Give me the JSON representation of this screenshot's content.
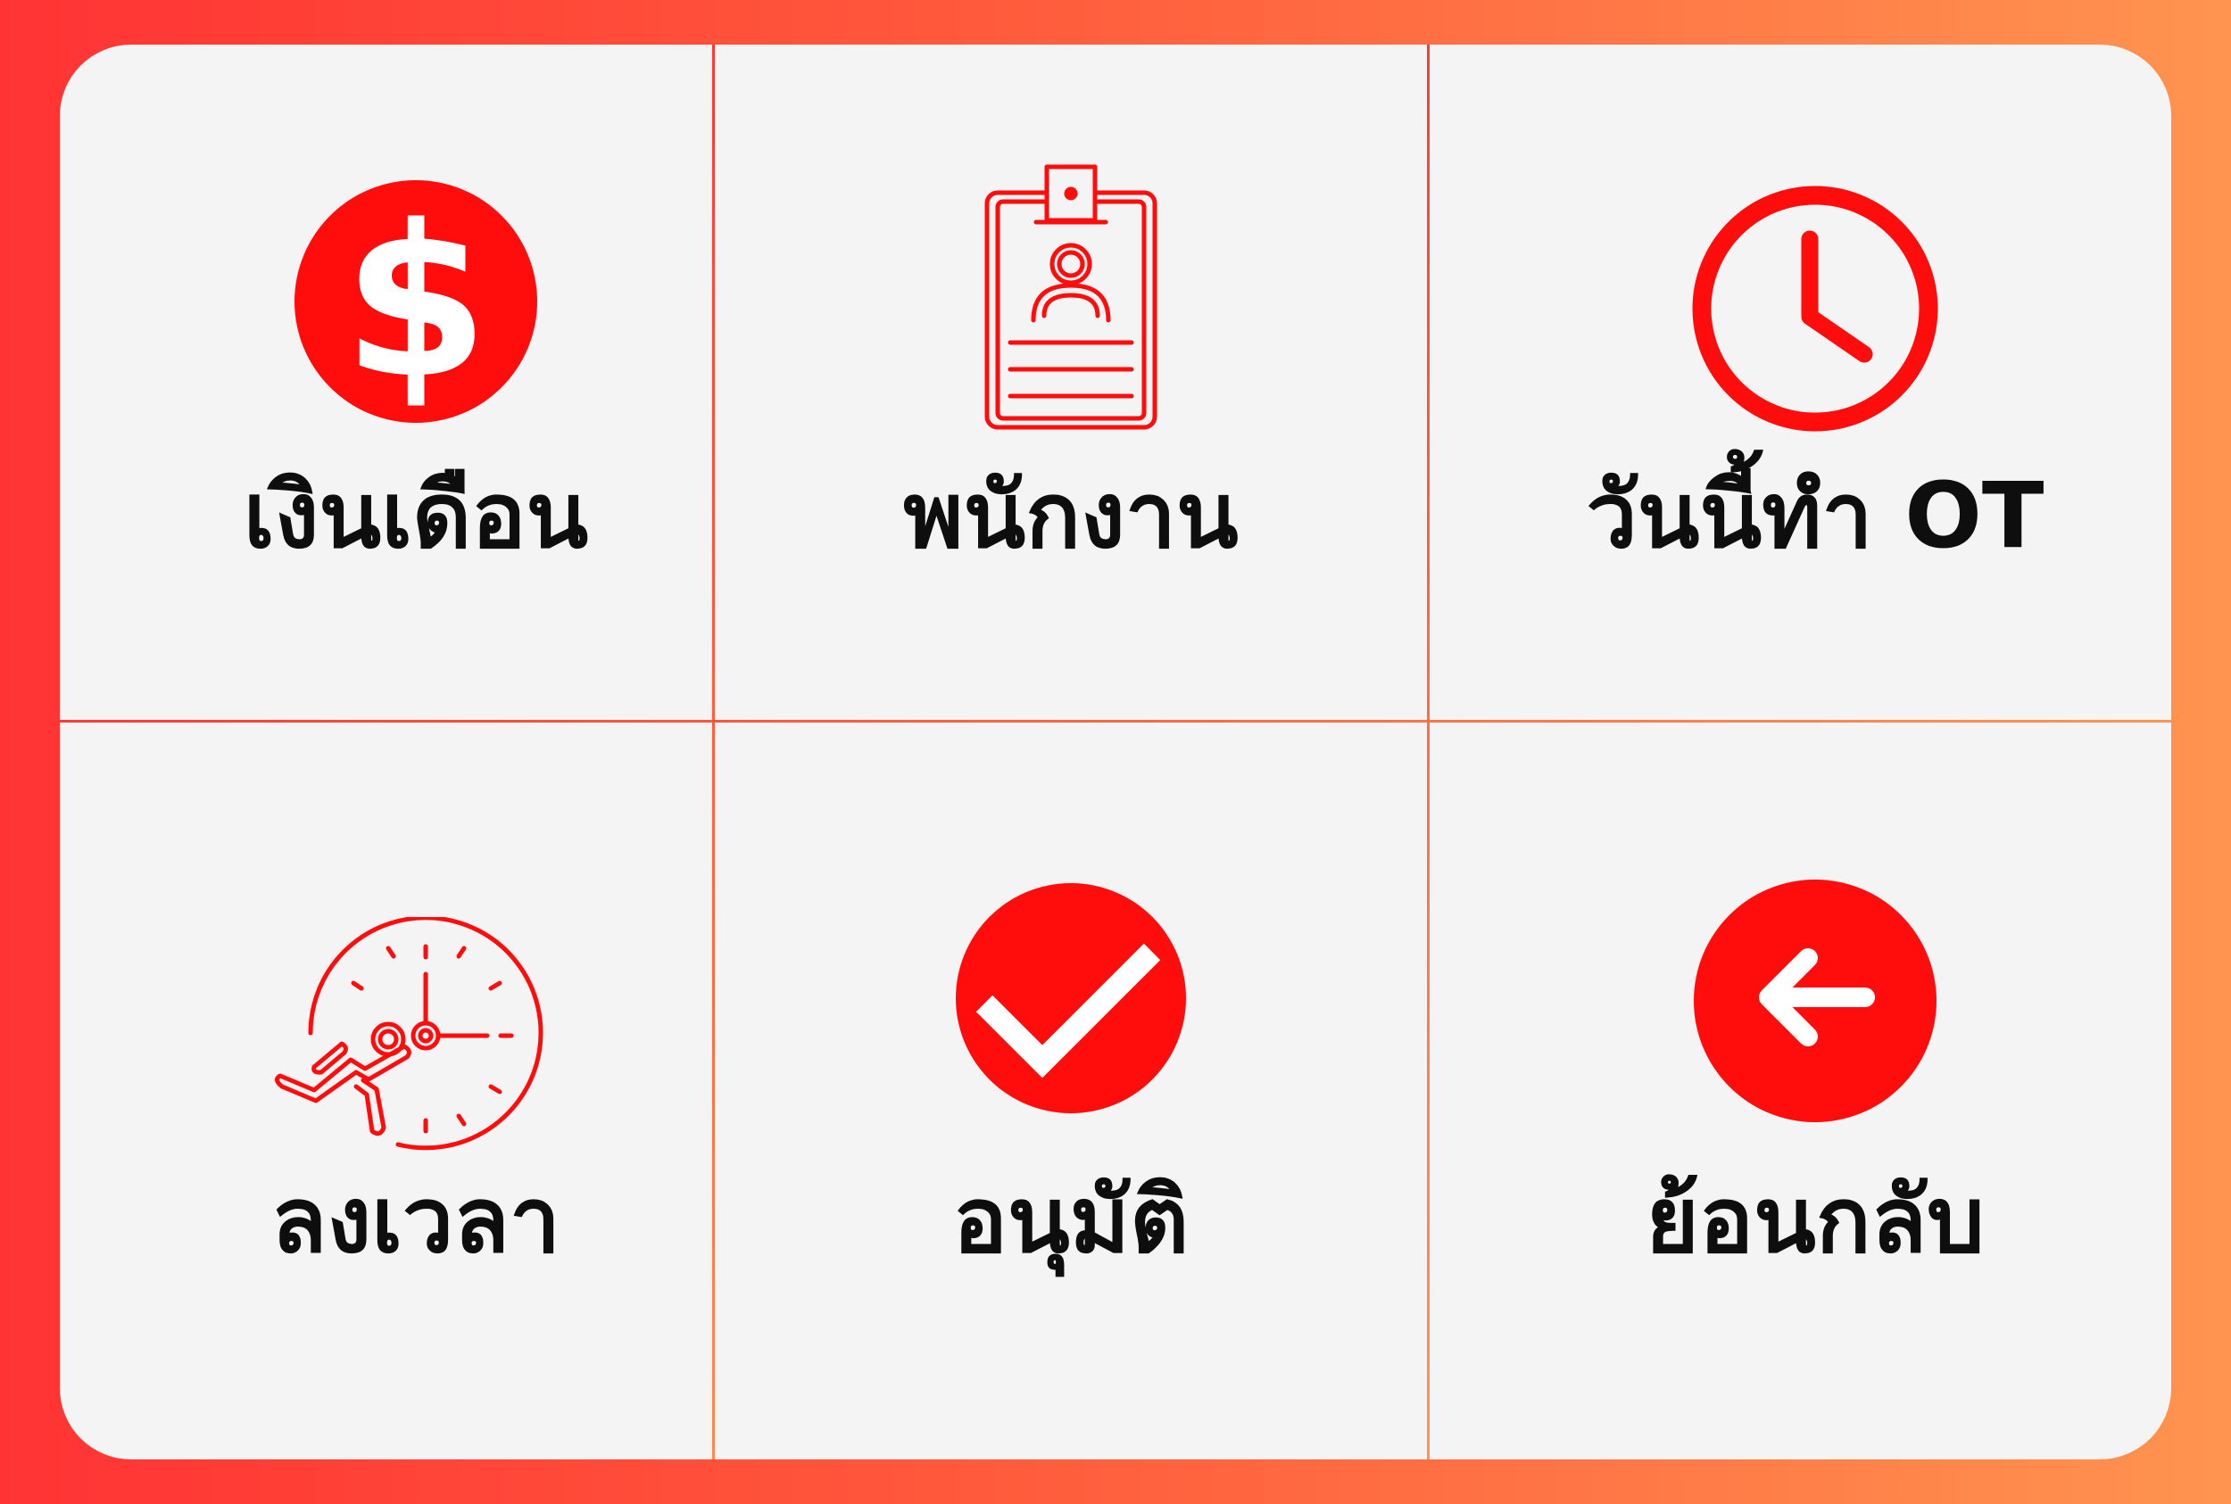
{
  "colors": {
    "accent": "#ff0d0d",
    "panel": "#f4f4f4",
    "text": "#0e0e0e",
    "gradient_start": "#ff3334",
    "gradient_end": "#ff9450"
  },
  "menu": {
    "items": [
      {
        "label": "เงินเดือน",
        "icon": "dollar-circle-icon"
      },
      {
        "label": "พนักงาน",
        "icon": "employee-badge-icon"
      },
      {
        "label": "วันนี้ทำ OT",
        "icon": "clock-icon"
      },
      {
        "label": "ลงเวลา",
        "icon": "running-clock-icon"
      },
      {
        "label": "อนุมัติ",
        "icon": "check-circle-icon"
      },
      {
        "label": "ย้อนกลับ",
        "icon": "back-arrow-circle-icon"
      }
    ]
  }
}
